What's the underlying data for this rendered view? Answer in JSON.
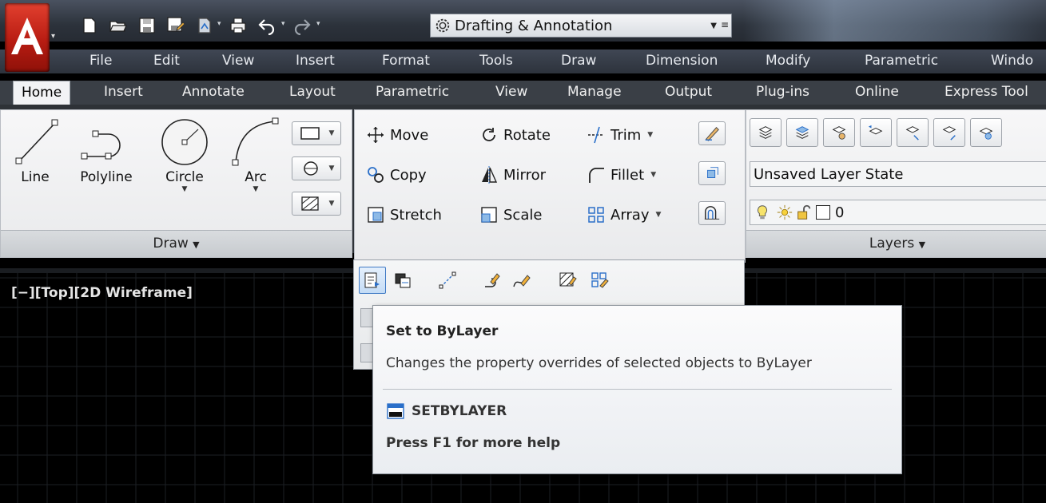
{
  "quick_access": {
    "workspace": "Drafting & Annotation"
  },
  "menubar": {
    "items": [
      "File",
      "Edit",
      "View",
      "Insert",
      "Format",
      "Tools",
      "Draw",
      "Dimension",
      "Modify",
      "Parametric",
      "Windo"
    ]
  },
  "ribbon_tabs": [
    "Home",
    "Insert",
    "Annotate",
    "Layout",
    "Parametric",
    "View",
    "Manage",
    "Output",
    "Plug-ins",
    "Online",
    "Express Tool"
  ],
  "draw_panel": {
    "title": "Draw",
    "tools": [
      "Line",
      "Polyline",
      "Circle",
      "Arc"
    ]
  },
  "modify_panel": {
    "rows": [
      [
        "Move",
        "Rotate",
        "Trim"
      ],
      [
        "Copy",
        "Mirror",
        "Fillet"
      ],
      [
        "Stretch",
        "Scale",
        "Array"
      ]
    ]
  },
  "layers_panel": {
    "title": "Layers",
    "layer_state": "Unsaved Layer State",
    "current_layer": "0"
  },
  "viewport": {
    "label": "[−][Top][2D Wireframe]"
  },
  "tooltip": {
    "title": "Set to ByLayer",
    "description": "Changes the property overrides of selected objects to ByLayer",
    "command": "SETBYLAYER",
    "help": "Press F1 for more help"
  },
  "colors": {
    "accent_red": "#d42b1e",
    "ribbon_bg": "#2e3237",
    "selection_blue": "#3f79c4"
  }
}
